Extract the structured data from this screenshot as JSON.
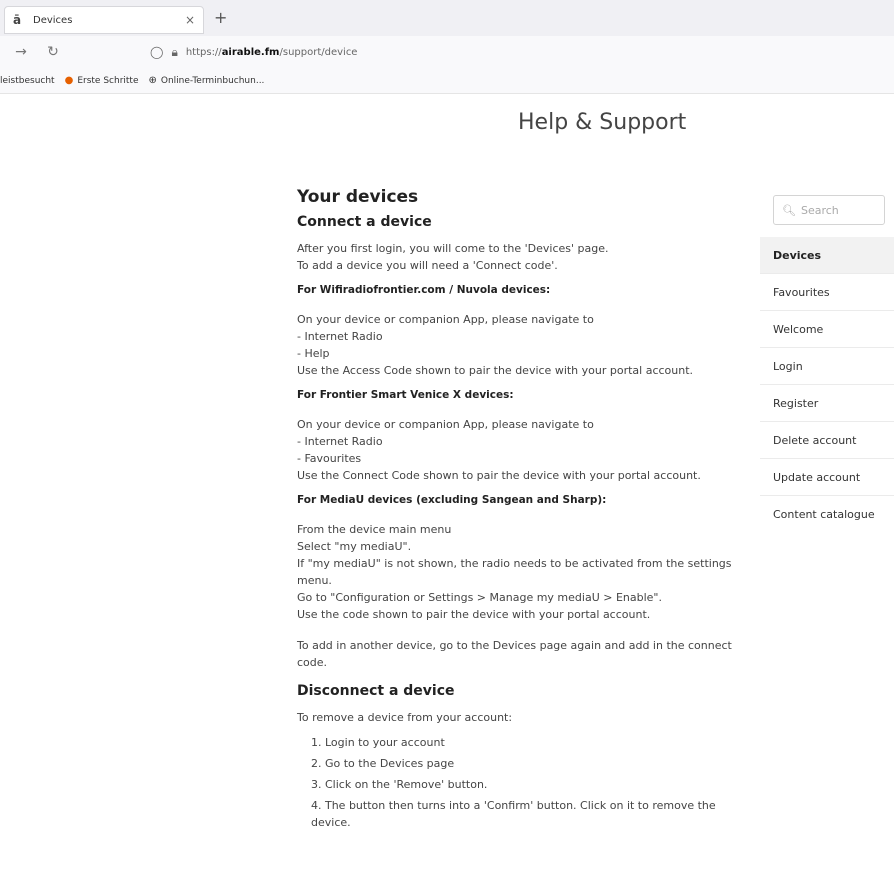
{
  "browser": {
    "tab_title": "Devices",
    "tab_close": "×",
    "new_tab": "+",
    "url_host": "airable.fm",
    "url_prefix": "https://",
    "url_path": "/support/device",
    "bookmarks": [
      "leistbesucht",
      "Erste Schritte",
      "Online-Terminbuchun..."
    ]
  },
  "page": {
    "title": "Help & Support"
  },
  "content": {
    "heading": "Your devices",
    "connect_heading": "Connect a device",
    "intro_lines": [
      "After you first login, you will come to the 'Devices' page.",
      "To add a device you will need a 'Connect code'."
    ],
    "sections": [
      {
        "title": "For Wifiradiofrontier.com / Nuvola devices:",
        "lines": [
          "On your device or companion App, please navigate to",
          "- Internet Radio",
          "- Help",
          "Use the Access Code shown to pair the device with your portal account."
        ]
      },
      {
        "title": "For Frontier Smart Venice X devices:",
        "lines": [
          "On your device or companion App, please navigate to",
          "- Internet Radio",
          "- Favourites",
          "Use the Connect Code shown to pair the device with your portal account."
        ]
      },
      {
        "title": "For MediaU devices (excluding Sangean and Sharp):",
        "lines": [
          "From the device main menu",
          "Select \"my mediaU\".",
          "If \"my mediaU\" is not shown, the radio needs to be activated from the settings menu.",
          "Go to \"Configuration or Settings > Manage my mediaU > Enable\".",
          "Use the code shown to pair the device with your portal account."
        ]
      }
    ],
    "add_another": "To add in another device, go to the Devices page again and add in the connect code.",
    "disconnect_heading": "Disconnect a device",
    "disconnect_intro": "To remove a device from your account:",
    "steps": [
      "1. Login to your account",
      "2. Go to the Devices page",
      "3. Click on the 'Remove' button.",
      "4. The button then turns into a 'Confirm' button. Click on it to remove the device."
    ]
  },
  "sidebar": {
    "search_placeholder": "Search",
    "items": [
      {
        "label": "Devices",
        "active": true
      },
      {
        "label": "Favourites",
        "active": false
      },
      {
        "label": "Welcome",
        "active": false
      },
      {
        "label": "Login",
        "active": false
      },
      {
        "label": "Register",
        "active": false
      },
      {
        "label": "Delete account",
        "active": false
      },
      {
        "label": "Update account",
        "active": false
      },
      {
        "label": "Content catalogue",
        "active": false
      }
    ]
  }
}
